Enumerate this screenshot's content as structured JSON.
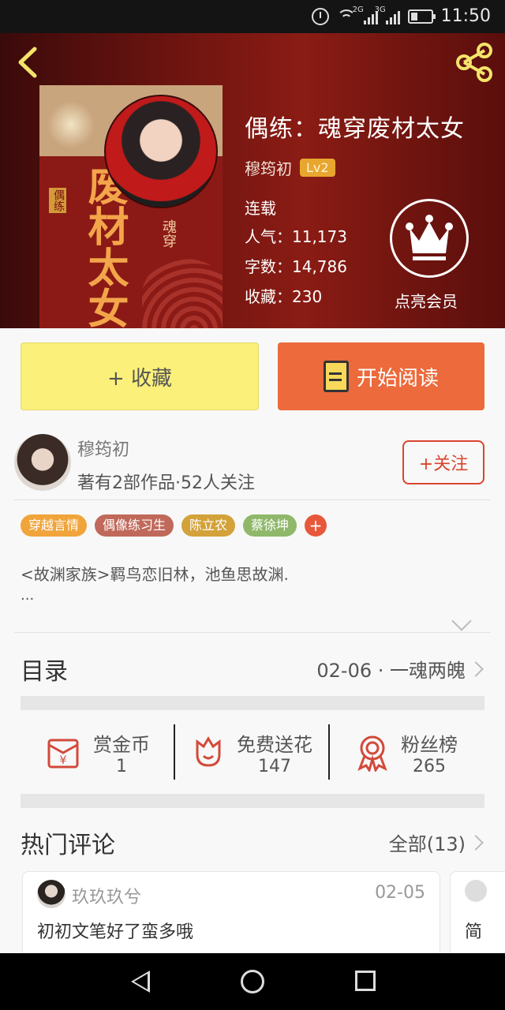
{
  "status_bar": {
    "time": "11:50",
    "net1": "2G",
    "net2": "3G"
  },
  "book": {
    "title": "偶练：魂穿废材太女",
    "author": "穆筠初",
    "level": "Lv2",
    "status": "连载",
    "popularity_label": "人气：",
    "popularity": "11,173",
    "words_label": "字数：",
    "words": "14,786",
    "favorites_label": "收藏：",
    "favorites": "230",
    "vip_label": "点亮会员",
    "cover_title": "废材太女",
    "cover_sub": "魂穿",
    "cover_tag": "偶练"
  },
  "actions": {
    "collect": "+ 收藏",
    "read": "开始阅读"
  },
  "author_info": {
    "name": "穆筠初",
    "stats": "著有2部作品·52人关注",
    "follow": "+关注"
  },
  "tags": [
    {
      "label": "穿越言情",
      "color": "#f0a43a"
    },
    {
      "label": "偶像练习生",
      "color": "#c0695a"
    },
    {
      "label": "陈立农",
      "color": "#d4a23a"
    },
    {
      "label": "蔡徐坤",
      "color": "#8fb86a"
    }
  ],
  "description": {
    "text": "<故渊家族>羁鸟恋旧林，池鱼思故渊.",
    "more": "..."
  },
  "catalog": {
    "title": "目录",
    "latest": "02-06 · 一魂两魄"
  },
  "rewards": [
    {
      "label": "赏金币",
      "value": "1"
    },
    {
      "label": "免费送花",
      "value": "147"
    },
    {
      "label": "粉丝榜",
      "value": "265"
    }
  ],
  "comments": {
    "title": "热门评论",
    "all": "全部(13)",
    "items": [
      {
        "user": "玖玖玖兮",
        "date": "02-05",
        "text": "初初文笔好了蛮多哦"
      },
      {
        "text": "简"
      }
    ]
  },
  "colors": {
    "accent": "#ec6a3c",
    "collect": "#fbf07a",
    "header": "#7a1812"
  }
}
